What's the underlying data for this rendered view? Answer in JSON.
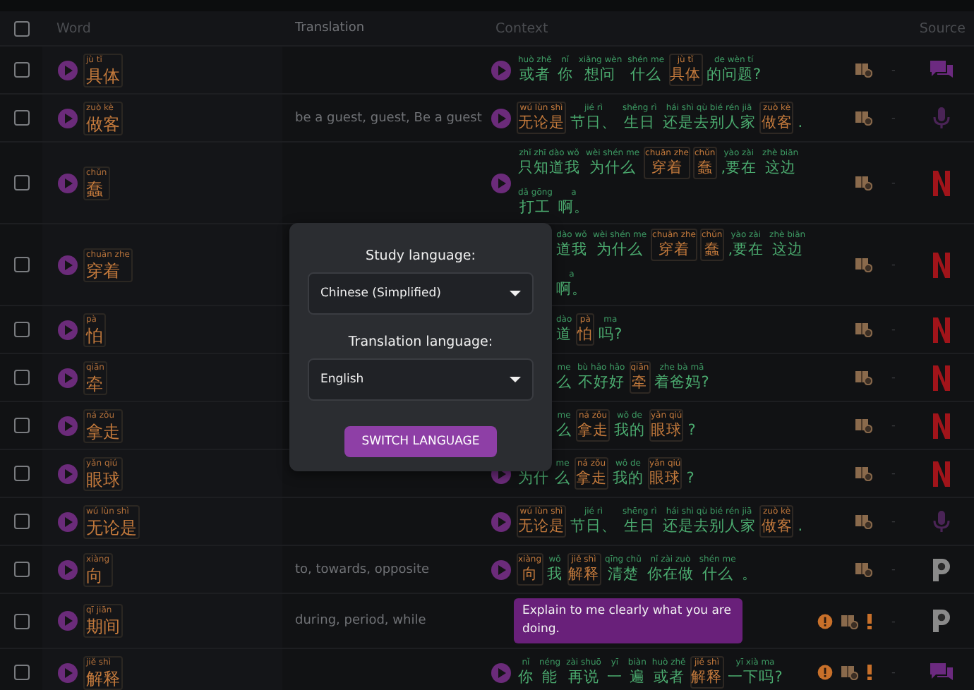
{
  "table": {
    "header_checkbox": {
      "checked": false
    },
    "columns": [
      "Word",
      "Translation",
      "Context",
      "Source"
    ],
    "rows": [
      {
        "checked": false,
        "word": {
          "pinyin": "jù tǐ",
          "hanzi": "具体"
        },
        "context": {
          "kind": "sentence",
          "segments": [
            {
              "py": "huò zhě",
              "zh": "或者",
              "hl": false
            },
            {
              "py": "nǐ",
              "zh": "你",
              "hl": false
            },
            {
              "py": "xiǎng wèn",
              "zh": "想问",
              "hl": false
            },
            {
              "py": "shén me",
              "zh": "什么",
              "hl": false
            },
            {
              "py": "jù tǐ",
              "zh": "具体",
              "hl": true
            },
            {
              "py": "de wèn tí",
              "zh": "的问题?",
              "hl": false
            }
          ]
        },
        "flagged": false,
        "dash": "-",
        "source": {
          "kind": "chat"
        }
      },
      {
        "checked": false,
        "word": {
          "pinyin": "zuò kè",
          "hanzi": "做客"
        },
        "translation": "be a guest, guest, Be a guest",
        "context": {
          "kind": "sentence",
          "segments": [
            {
              "py": "wú lùn shì",
              "zh": "无论是",
              "hl": true
            },
            {
              "py": "jié rì",
              "zh": "节日、",
              "hl": false
            },
            {
              "py": "shēng rì",
              "zh": "生日",
              "hl": false
            },
            {
              "py": "hái shì qù bié rén jiā",
              "zh": "还是去别人家",
              "hl": false
            },
            {
              "py": "zuò kè",
              "zh": "做客",
              "hl": true
            },
            {
              "zh": ".",
              "hl": false
            }
          ]
        },
        "flagged": false,
        "dash": "-",
        "source": {
          "kind": "mic"
        }
      },
      {
        "checked": false,
        "word": {
          "pinyin": "chǔn",
          "hanzi": "蠢"
        },
        "context": {
          "kind": "sentence",
          "segments": [
            {
              "py": "zhǐ zhī dào wǒ",
              "zh": "只知道我",
              "hl": false
            },
            {
              "py": "wèi shén me",
              "zh": "为什么",
              "hl": false
            },
            {
              "py": "chuān zhe",
              "zh": "穿着",
              "hl": true
            },
            {
              "py": "chǔn",
              "zh": "蠢",
              "hl": true
            },
            {
              "py": "yào zài",
              "zh": ",要在",
              "hl": false
            },
            {
              "py": "zhè biān",
              "zh": "这边",
              "hl": false
            },
            {
              "py": "dǎ gōng",
              "zh": "打工",
              "hl": false
            },
            {
              "py": "a",
              "zh": "啊。",
              "hl": false
            }
          ]
        },
        "flagged": false,
        "dash": "-",
        "source": {
          "kind": "netflix"
        }
      },
      {
        "checked": false,
        "word": {
          "pinyin": "chuān zhe",
          "hanzi": "穿着"
        },
        "context": {
          "kind": "sentence",
          "covered": true,
          "segments": [
            {
              "py": "dào wǒ",
              "zh": "道我",
              "hl": false
            },
            {
              "py": "wèi shén me",
              "zh": "为什么",
              "hl": false
            },
            {
              "py": "chuān zhe",
              "zh": "穿着",
              "hl": true
            },
            {
              "py": "chǔn",
              "zh": "蠢",
              "hl": true
            },
            {
              "py": "yào zài",
              "zh": ",要在",
              "hl": false
            },
            {
              "py": "zhè biān",
              "zh": "这边",
              "hl": false
            },
            {
              "py": "a",
              "zh": "啊。",
              "hl": false
            }
          ]
        },
        "flagged": false,
        "dash": "-",
        "source": {
          "kind": "netflix"
        }
      },
      {
        "checked": false,
        "word": {
          "pinyin": "pà",
          "hanzi": "怕"
        },
        "context": {
          "kind": "sentence",
          "covered": true,
          "segments": [
            {
              "py": "dào",
              "zh": "道",
              "hl": false
            },
            {
              "py": "pà",
              "zh": "怕",
              "hl": true
            },
            {
              "py": "ma",
              "zh": "吗?",
              "hl": false
            }
          ]
        },
        "flagged": false,
        "dash": "-",
        "source": {
          "kind": "netflix"
        }
      },
      {
        "checked": false,
        "word": {
          "pinyin": "qiān",
          "hanzi": "牵"
        },
        "context": {
          "kind": "sentence",
          "covered": true,
          "segments": [
            {
              "py": "me",
              "zh": "么",
              "hl": false
            },
            {
              "py": "bù hǎo hǎo",
              "zh": "不好好",
              "hl": false
            },
            {
              "py": "qiān",
              "zh": "牵",
              "hl": true
            },
            {
              "py": "zhe bà mā",
              "zh": "着爸妈?",
              "hl": false
            }
          ]
        },
        "flagged": false,
        "dash": "-",
        "source": {
          "kind": "netflix"
        }
      },
      {
        "checked": false,
        "word": {
          "pinyin": "ná zǒu",
          "hanzi": "拿走"
        },
        "context": {
          "kind": "sentence",
          "covered": true,
          "segments": [
            {
              "py": "me",
              "zh": "么",
              "hl": false
            },
            {
              "py": "ná zǒu",
              "zh": "拿走",
              "hl": true
            },
            {
              "py": "wǒ de",
              "zh": "我的",
              "hl": false
            },
            {
              "py": "yǎn qiú",
              "zh": "眼球",
              "hl": true
            },
            {
              "zh": "?",
              "hl": false
            }
          ]
        },
        "flagged": false,
        "dash": "-",
        "source": {
          "kind": "netflix"
        }
      },
      {
        "checked": false,
        "word": {
          "pinyin": "yǎn qiú",
          "hanzi": "眼球"
        },
        "context": {
          "kind": "sentence",
          "segments": [
            {
              "zh": "为什",
              "hl": false
            },
            {
              "py": "me",
              "zh": "么",
              "hl": false
            },
            {
              "py": "ná zǒu",
              "zh": "拿走",
              "hl": true
            },
            {
              "py": "wǒ de",
              "zh": "我的",
              "hl": false
            },
            {
              "py": "yǎn qiú",
              "zh": "眼球",
              "hl": true
            },
            {
              "zh": "?",
              "hl": false
            }
          ]
        },
        "flagged": false,
        "dash": "-",
        "source": {
          "kind": "netflix"
        }
      },
      {
        "checked": false,
        "word": {
          "pinyin": "wú lùn shì",
          "hanzi": "无论是"
        },
        "context": {
          "kind": "sentence",
          "segments": [
            {
              "py": "wú lùn shì",
              "zh": "无论是",
              "hl": true
            },
            {
              "py": "jié rì",
              "zh": "节日、",
              "hl": false
            },
            {
              "py": "shēng rì",
              "zh": "生日",
              "hl": false
            },
            {
              "py": "hái shì qù bié rén jiā",
              "zh": "还是去别人家",
              "hl": false
            },
            {
              "py": "zuò kè",
              "zh": "做客",
              "hl": true
            },
            {
              "zh": ".",
              "hl": false
            }
          ]
        },
        "flagged": false,
        "dash": "-",
        "source": {
          "kind": "mic"
        }
      },
      {
        "checked": false,
        "word": {
          "pinyin": "xiàng",
          "hanzi": "向"
        },
        "translation": "to, towards, opposite",
        "context": {
          "kind": "sentence",
          "segments": [
            {
              "py": "xiàng",
              "zh": "向",
              "hl": true
            },
            {
              "py": "wǒ",
              "zh": "我",
              "hl": false
            },
            {
              "py": "jiě shì",
              "zh": "解释",
              "hl": true
            },
            {
              "py": "qīng chǔ",
              "zh": "清楚",
              "hl": false
            },
            {
              "py": "nǐ zài zuò",
              "zh": "你在做",
              "hl": false
            },
            {
              "py": "shén me",
              "zh": "什么",
              "hl": false
            },
            {
              "zh": "。",
              "hl": false
            }
          ]
        },
        "flagged": false,
        "dash": "-",
        "source": {
          "kind": "p"
        }
      },
      {
        "checked": false,
        "word": {
          "pinyin": "qī jiān",
          "hanzi": "期间"
        },
        "translation": "during, period, while",
        "context": {
          "kind": "bubble",
          "text": "Explain to me clearly what you are doing."
        },
        "flagged": true,
        "dash": "-",
        "source": {
          "kind": "p"
        }
      },
      {
        "checked": false,
        "word": {
          "pinyin": "jiě shì",
          "hanzi": "解释"
        },
        "context": {
          "kind": "sentence",
          "segments": [
            {
              "py": "nǐ",
              "zh": "你",
              "hl": false
            },
            {
              "py": "néng",
              "zh": "能",
              "hl": false
            },
            {
              "py": "zài shuō",
              "zh": "再说",
              "hl": false
            },
            {
              "py": "yī",
              "zh": "一",
              "hl": false
            },
            {
              "py": "biàn",
              "zh": "遍",
              "hl": false
            },
            {
              "py": "huò zhě",
              "zh": "或者",
              "hl": false
            },
            {
              "py": "jiě shì",
              "zh": "解释",
              "hl": true
            },
            {
              "py": "yī xià ma",
              "zh": "一下吗?",
              "hl": false
            }
          ]
        },
        "flagged": true,
        "dash": "-",
        "source": {
          "kind": "chat"
        }
      }
    ]
  },
  "dialog": {
    "study_label": "Study language:",
    "study_value": "Chinese (Simplified)",
    "translation_label": "Translation language:",
    "translation_value": "English",
    "button": "SWITCH LANGUAGE"
  }
}
